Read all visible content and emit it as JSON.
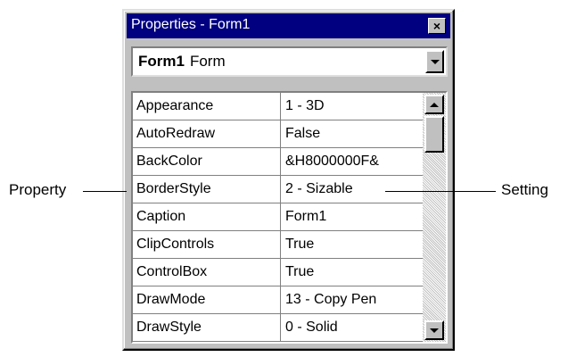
{
  "window": {
    "title": "Properties - Form1",
    "close_glyph": "×"
  },
  "object_combo": {
    "object_name": "Form1",
    "object_type": "Form"
  },
  "properties": [
    {
      "name": "Appearance",
      "value": "1 - 3D"
    },
    {
      "name": "AutoRedraw",
      "value": "False"
    },
    {
      "name": "BackColor",
      "value": "&H8000000F&"
    },
    {
      "name": "BorderStyle",
      "value": "2 - Sizable"
    },
    {
      "name": "Caption",
      "value": "Form1"
    },
    {
      "name": "ClipControls",
      "value": "True"
    },
    {
      "name": "ControlBox",
      "value": "True"
    },
    {
      "name": "DrawMode",
      "value": "13 - Copy Pen"
    },
    {
      "name": "DrawStyle",
      "value": "0 - Solid"
    }
  ],
  "callouts": {
    "left": "Property",
    "right": "Setting"
  },
  "colors": {
    "title_bar": "#000080",
    "window_face": "#c0c0c0"
  }
}
